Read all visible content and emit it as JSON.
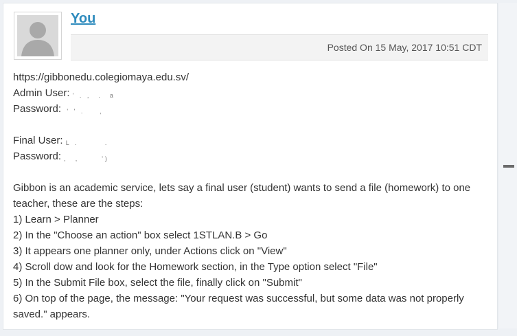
{
  "post": {
    "author": "You",
    "posted_on": "Posted On 15 May, 2017 10:51 CDT",
    "body": {
      "url": "https://gibbonedu.colegiomaya.edu.sv/",
      "admin_user_label": "Admin User:",
      "admin_password_label": "Password:",
      "final_user_label": "Final User:",
      "final_password_label": "Password:",
      "intro": "Gibbon is an academic service, lets say a final user (student) wants to send a file (homework) to one teacher, these are the steps:",
      "steps": [
        "1) Learn > Planner",
        "2) In the \"Choose an action\" box select 1STLAN.B > Go",
        "3) It appears one planner only, under Actions click on \"View\"",
        "4) Scroll dow and look for the Homework section, in the Type option select \"File\"",
        "5) In the Submit File box, select the file, finally click on \"Submit\"",
        "6) On top of the page, the message: \"Your request was successful, but some data was not properly saved.\" appears."
      ]
    }
  },
  "icons": {
    "avatar": "default-user-avatar-icon",
    "scroll": "scroll-handle-icon"
  },
  "colors": {
    "link": "#2e8bbd",
    "meta_bg": "#f3f3f3",
    "text": "#333333",
    "page_bg": "#eef1f5"
  }
}
